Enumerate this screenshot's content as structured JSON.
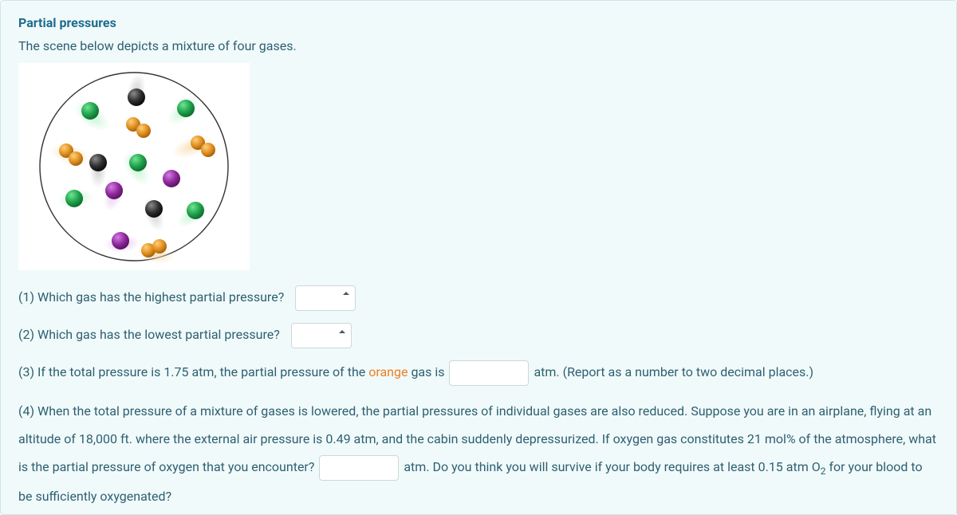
{
  "title": "Partial pressures",
  "intro": "The scene below depicts a mixture of four gases.",
  "q1": {
    "text": "(1) Which gas has the highest partial pressure?"
  },
  "q2": {
    "text": "(2) Which gas has the lowest partial pressure?"
  },
  "q3": {
    "pre": "(3) If the total pressure is 1.75 atm, the partial pressure of the ",
    "orange": "orange",
    "mid": " gas is ",
    "post": " atm.  (Report as a number to two decimal places.)"
  },
  "q4": {
    "line1": "(4) When the total pressure of a mixture of gases is lowered, the partial pressures of individual gases are also reduced.  Suppose you are in an airplane, flying at an altitude of 18,000 ft. where the external air pressure is 0.49 atm, and the cabin suddenly depressurized.  If oxygen gas constitutes 21 mol% of the atmosphere, what is the partial pressure of oxygen that you encounter? ",
    "post_a": " atm.  Do you think you will survive if your body requires at least 0.15 atm O",
    "post_b": " for your blood to be sufficiently oxygenated?",
    "sub": "2"
  },
  "colors": {
    "green": "#1fa24a",
    "orange": "#e09020",
    "purple": "#8e2a9b",
    "dark": "#2e2e2e"
  }
}
